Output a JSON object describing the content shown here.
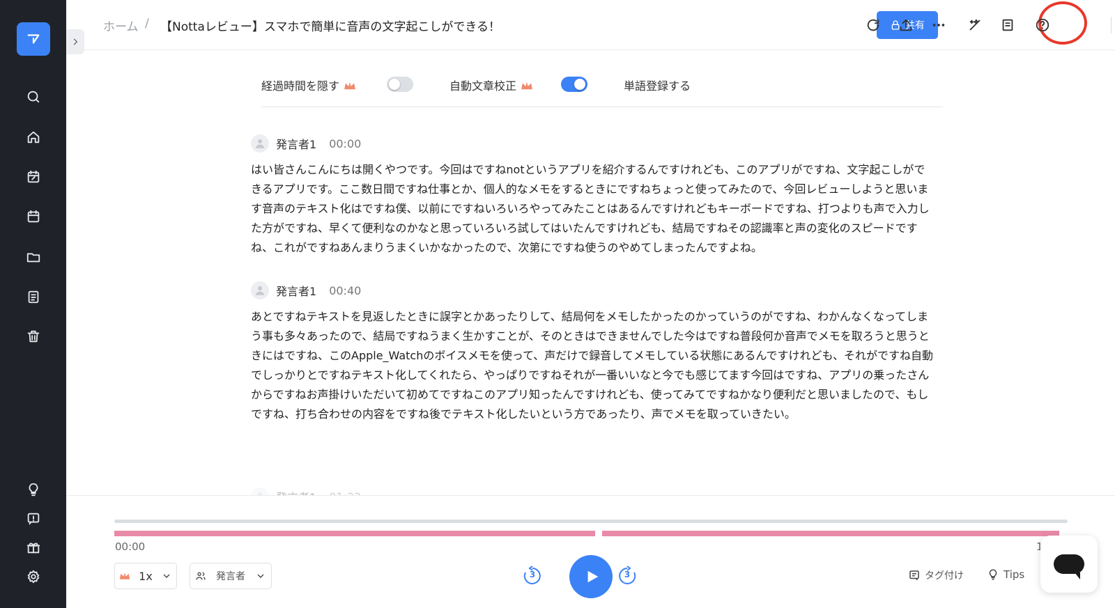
{
  "breadcrumb": {
    "home": "ホーム",
    "separator": "/",
    "title": "【Nottaレビュー】スマホで簡単に音声の文字起こしができる！"
  },
  "toolbar": {
    "share_label": "共有"
  },
  "options": {
    "hide_elapsed": "経過時間を隠す",
    "auto_correct": "自動文章校正",
    "register_words": "単語登録する",
    "hide_elapsed_on": false,
    "auto_correct_on": true
  },
  "segments": [
    {
      "speaker": "発言者1",
      "time": "00:00",
      "text": "はい皆さんこんにちは開くやつです。今回はですねnotというアプリを紹介するんですけれども、このアプリがですね、文字起こしができるアプリです。ここ数日間ですね仕事とか、個人的なメモをするときにですねちょっと使ってみたので、今回レビューしようと思います音声のテキスト化はですね僕、以前にですねいろいろやってみたことはあるんですけれどもキーボードですね、打つよりも声で入力した方がですね、早くて便利なのかなと思っていろいろ試してはいたんですけれども、結局ですねその認識率と声の変化のスピードですね、これがですねあんまりうまくいかなかったので、次第にですね使うのやめてしまったんですよね。"
    },
    {
      "speaker": "発言者1",
      "time": "00:40",
      "text": "あとですねテキストを見返したときに誤字とかあったりして、結局何をメモしたかったのかっていうのがですね、わかんなくなってしまう事も多々あったので、結局ですねうまく生かすことが、そのときはできませんでした今はですね普段何か音声でメモを取ろうと思うときにはですね、このApple_Watchのボイスメモを使って、声だけで録音してメモしている状態にあるんですけれども、それがですね自動でしっかりとですねテキスト化してくれたら、やっぱりですねそれが一番いいなと今でも感じてます今回はですね、アプリの乗ったさんからですねお声掛けいただいて初めてですねこのアプリ知ったんですけれども、使ってみてですねかなり便利だと思いましたので、もしですね、打ち合わせの内容をですね後でテキスト化したいという方であったり、声でメモを取っていきたい。"
    },
    {
      "speaker": "発言者1",
      "time": "01:22",
      "text": ""
    }
  ],
  "player": {
    "time_start": "00:00",
    "time_end": "1",
    "progress": 0,
    "speed": "1x",
    "speaker_filter": "発言者",
    "skip_back": "3",
    "skip_forward": "3",
    "tag_label": "タグ付け",
    "tips_label": "Tips"
  },
  "colors": {
    "accent": "#3b82f6",
    "sidebar": "#1f2329",
    "timeline": "#e88aa8",
    "highlight": "#e8382b"
  },
  "icons": [
    "logo-icon",
    "search-icon",
    "home-icon",
    "calendar-edit-icon",
    "calendar-icon",
    "folder-icon",
    "document-icon",
    "trash-icon",
    "bulb-icon",
    "feedback-icon",
    "gift-icon",
    "settings-icon",
    "lock-icon",
    "sync-icon",
    "upload-icon",
    "more-icon",
    "magic-wand-icon",
    "notes-icon",
    "help-icon"
  ]
}
